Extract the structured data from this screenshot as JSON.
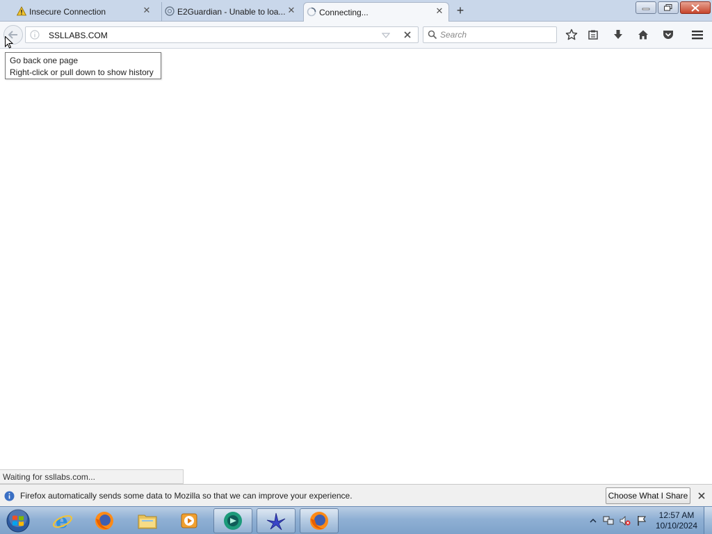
{
  "tabs": [
    {
      "label": "Insecure Connection",
      "icon": "warning-icon",
      "active": false
    },
    {
      "label": "E2Guardian - Unable to loa...",
      "icon": "globe-icon",
      "active": false
    },
    {
      "label": "Connecting...",
      "icon": "loading-icon",
      "active": true
    }
  ],
  "urlbar": {
    "value": "SSLLABS.COM"
  },
  "search": {
    "placeholder": "Search"
  },
  "tooltip": {
    "line1": "Go back one page",
    "line2": "Right-click or pull down to show history"
  },
  "status": {
    "text": "Waiting for ssllabs.com..."
  },
  "notification": {
    "text": "Firefox automatically sends some data to Mozilla so that we can improve your experience.",
    "button_label": "Choose What I Share"
  },
  "taskbar": {
    "apps": [
      "internet-explorer",
      "firefox",
      "file-explorer",
      "media-player",
      "chat-app",
      "bird-app",
      "firefox-running"
    ],
    "clock": {
      "time": "12:57 AM",
      "date": "10/10/2024"
    }
  },
  "colors": {
    "tabstrip": "#c9d7ea",
    "navbar": "#f5f7fa",
    "taskbar": "#8fb0d4",
    "close_button": "#c6452c"
  }
}
